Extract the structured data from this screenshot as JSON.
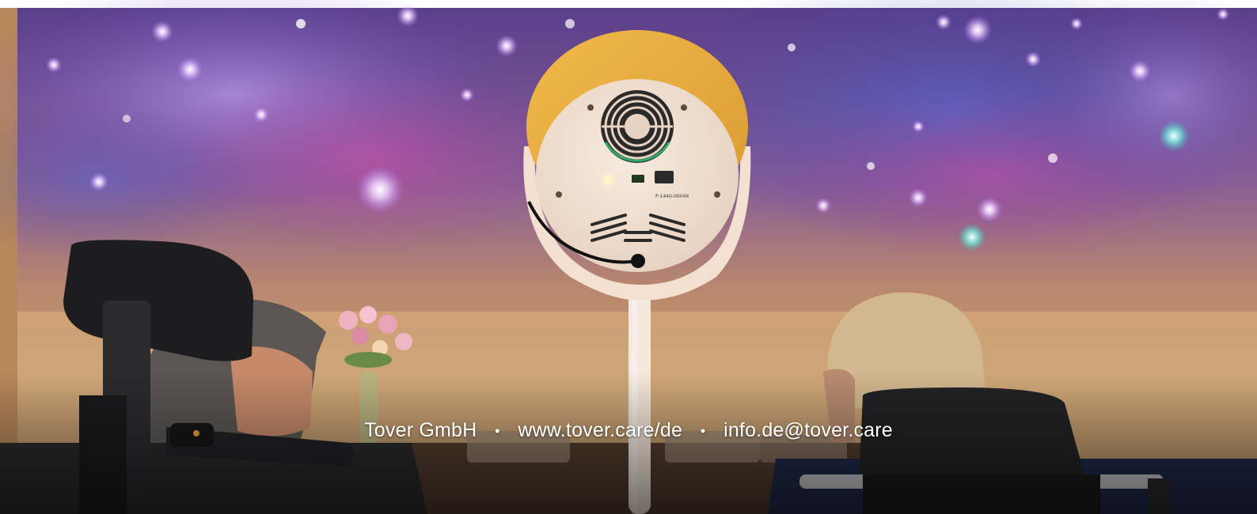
{
  "footer": {
    "company": "Tover GmbH",
    "separator": "•",
    "website": "www.tover.care/de",
    "email": "info.de@tover.care"
  },
  "device": {
    "serial_label": "P-1440-00046"
  },
  "colors": {
    "device_shell": "#e6a83c",
    "device_face": "#f3e2d2",
    "wall_warm": "#c8966a",
    "nebula_purple": "#7a55c8",
    "nebula_magenta": "#c23c9a",
    "footer_text": "#ffffff"
  }
}
